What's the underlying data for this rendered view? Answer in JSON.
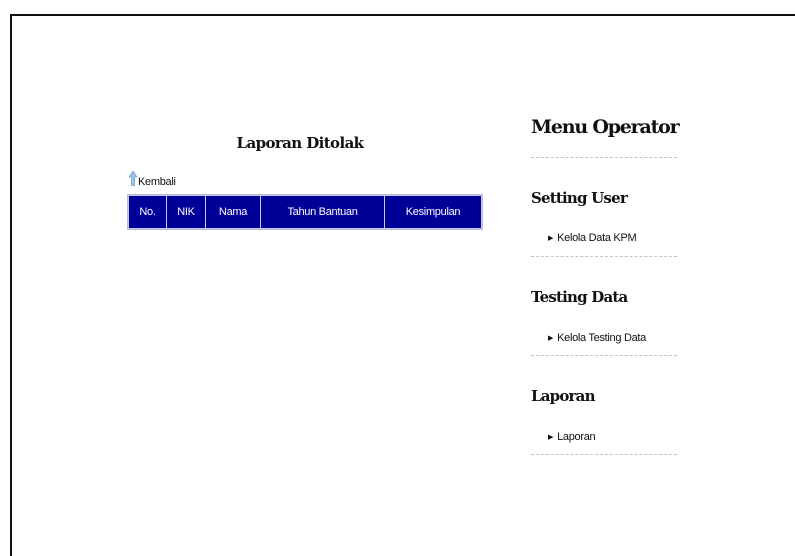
{
  "report": {
    "title": "Laporan Ditolak",
    "back_label": "Kembali",
    "columns": [
      "No.",
      "NIK",
      "Nama",
      "Tahun Bantuan",
      "Kesimpulan"
    ],
    "rows": []
  },
  "sidebar": {
    "title": "Menu Operator",
    "sections": [
      {
        "heading": "Setting User",
        "link": "Kelola Data KPM"
      },
      {
        "heading": "Testing Data",
        "link": "Kelola Testing Data"
      },
      {
        "heading": "Laporan",
        "link": "Laporan"
      }
    ]
  },
  "colors": {
    "table_header_bg": "#000099",
    "table_header_text": "#ffffff",
    "arrow_icon": "#9cc3e6"
  },
  "icons": {
    "back": "up-arrow-icon",
    "menu_bullet": "triangle-right-icon"
  }
}
